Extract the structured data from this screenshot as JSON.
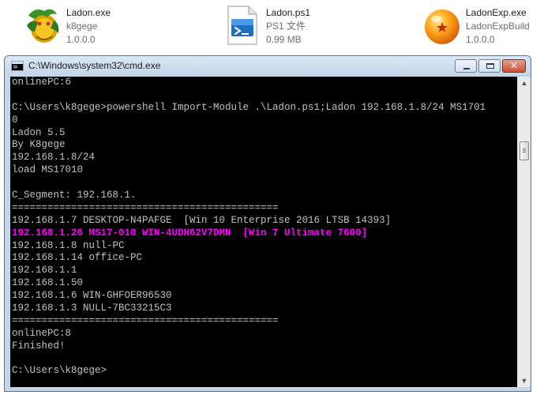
{
  "files": [
    {
      "name": "Ladon.exe",
      "sub": "k8gege",
      "extra": "1.0.0.0",
      "icon": "exe-app-icon"
    },
    {
      "name": "Ladon.ps1",
      "sub": "PS1 文件",
      "extra": "0.99 MB",
      "icon": "powershell-script-icon"
    },
    {
      "name": "LadonExp.exe",
      "sub": "LadonExpBuild",
      "extra": "1.0.0.0",
      "icon": "dragon-ball-icon"
    }
  ],
  "window": {
    "title": "C:\\Windows\\system32\\cmd.exe"
  },
  "console": {
    "lines": [
      "onlinePC:6",
      "",
      "C:\\Users\\k8gege>powershell Import-Module .\\Ladon.ps1;Ladon 192.168.1.8/24 MS1701",
      "0",
      "Ladon 5.5",
      "By K8gege",
      "192.168.1.8/24",
      "load MS17010",
      "",
      "C_Segment: 192.168.1.",
      "=============================================",
      "192.168.1.7 DESKTOP-N4PAFGE  [Win 10 Enterprise 2016 LTSB 14393]",
      "192.168.1.26 MS17-010 WIN-4UDH62V7DMN  [Win 7 Ultimate 7600]",
      "192.168.1.8 null-PC",
      "192.168.1.14 office-PC",
      "192.168.1.1",
      "192.168.1.50",
      "192.168.1.6 WIN-GHFOER96530",
      "192.168.1.3 NULL-7BC33215C3",
      "=============================================",
      "onlinePC:8",
      "Finished!",
      "",
      "C:\\Users\\k8gege>"
    ],
    "highlight_line": 12,
    "colors": {
      "text": "#c0c0c0",
      "highlight": "#ff00ff",
      "background": "#000000"
    }
  }
}
